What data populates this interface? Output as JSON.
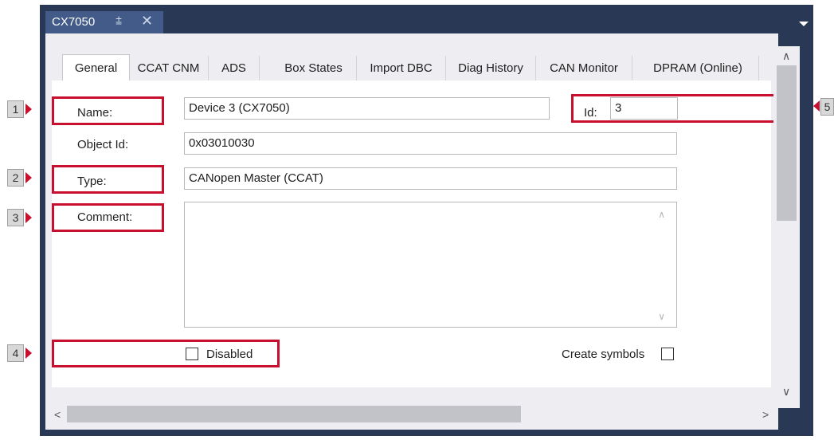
{
  "document_tab": {
    "title": "CX7050",
    "pin_icon": "pin-icon",
    "close_icon": "close-icon"
  },
  "tabs": [
    "General",
    "CCAT CNM",
    "ADS",
    "Box States",
    "Import DBC",
    "Diag History",
    "CAN Monitor",
    "DPRAM (Online)"
  ],
  "active_tab": "General",
  "form": {
    "name_label": "Name:",
    "name_value": "Device 3 (CX7050)",
    "id_label": "Id:",
    "id_value": "3",
    "object_id_label": "Object Id:",
    "object_id_value": "0x03010030",
    "type_label": "Type:",
    "type_value": "CANopen Master (CCAT)",
    "comment_label": "Comment:",
    "comment_value": "",
    "disabled_label": "Disabled",
    "disabled_checked": false,
    "create_symbols_label": "Create symbols",
    "create_symbols_checked": false
  },
  "callouts": {
    "c1": "1",
    "c2": "2",
    "c3": "3",
    "c4": "4",
    "c5": "5"
  },
  "colors": {
    "highlight": "#c8102e",
    "title_bar": "#293955",
    "active_doc_tab": "#425b89"
  }
}
